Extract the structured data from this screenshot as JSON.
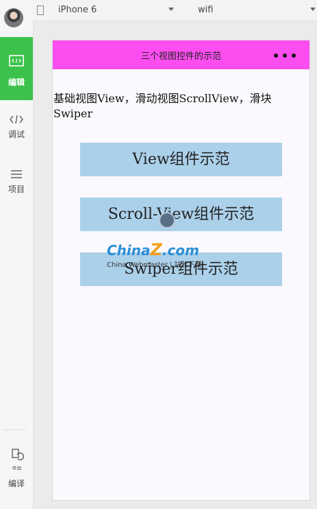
{
  "sidebar": {
    "items": [
      {
        "label": "编辑",
        "icon": "code-window-icon"
      },
      {
        "label": "调试",
        "icon": "code-brackets-icon"
      },
      {
        "label": "项目",
        "icon": "hamburger-icon"
      },
      {
        "label": "编译",
        "icon": "compile-icon"
      }
    ],
    "active_color": "#3cc24a"
  },
  "devbar": {
    "device": "iPhone 6",
    "network": "wifi"
  },
  "phone": {
    "nav_title": "三个视图控件的示范",
    "nav_color": "#fc4ef0",
    "intro": "基础视图View，滑动视图ScrollView，滑块Swiper",
    "buttons": [
      {
        "label": "View组件示范"
      },
      {
        "label": "Scroll-View组件示范"
      },
      {
        "label": "Swiper组件示范"
      }
    ],
    "button_color": "#abd0ea"
  },
  "watermark": {
    "brand_prefix": "China",
    "brand_z": "Z",
    "brand_suffix": ".com",
    "sub": "China Webmaster | 站长下载"
  }
}
